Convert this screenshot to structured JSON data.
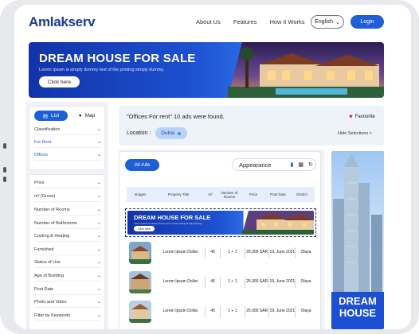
{
  "header": {
    "logo": "Amlakserv",
    "nav": [
      "About Us",
      "Features",
      "How it Works"
    ],
    "language": "English",
    "login_label": "Login"
  },
  "hero": {
    "title": "DREAM HOUSE FOR SALE",
    "subtitle": "Lorem Ipsum is simply dummy text of the printing simply dummy.",
    "button": "Click here"
  },
  "sidebar": {
    "tab_list": "List",
    "tab_map": "Map",
    "filters_top": [
      "Classification",
      "For Rent",
      "Offices"
    ],
    "filters": [
      "Price",
      "m² (Gross)",
      "Number of Rooms",
      "Number of Bathrooms",
      "Cooling & Heating",
      "Furnished",
      "Status of Use",
      "Age of Building",
      "Post Date",
      "Photo and Video",
      "Filter by Keywords"
    ]
  },
  "offers": {
    "title": "\"Offices For rent\" 10 ads were found.",
    "favourite": "Favourite",
    "location_label": "Location :",
    "location_chip": "Dubai",
    "hide_selections": "Hide Selections"
  },
  "listing": {
    "all_ads": "All Ads",
    "appearance": "Appearance",
    "columns": [
      "Images",
      "Property Title",
      "m²",
      "Number of Rooms",
      "Price",
      "Post Date",
      "District"
    ],
    "ad": {
      "title": "DREAM HOUSE FOR SALE",
      "subtitle": "Lorem Ipsum is simply dummy text of the printing simply dummy.",
      "button": "Click here"
    },
    "rows": [
      {
        "title": "Lorem Ipsum Dollar",
        "m2": "45",
        "rooms": "1 + 1",
        "price": "25,000 SAR",
        "date": "19, June 2021",
        "district": "Olaya"
      },
      {
        "title": "Lorem Ipsum Dollar",
        "m2": "45",
        "rooms": "1 + 1",
        "price": "25,000 SAR",
        "date": "19, June 2021",
        "district": "Olaya"
      },
      {
        "title": "Lorem Ipsum Dollar",
        "m2": "45",
        "rooms": "1 + 1",
        "price": "25,000 SAR",
        "date": "19, June 2021",
        "district": "Olaya"
      }
    ]
  },
  "right_ad": {
    "line1": "DREAM",
    "line2": "HOUSE"
  },
  "colors": {
    "primary": "#1d5fd6",
    "brand": "#1a3c8f",
    "heart": "#e0244a"
  }
}
